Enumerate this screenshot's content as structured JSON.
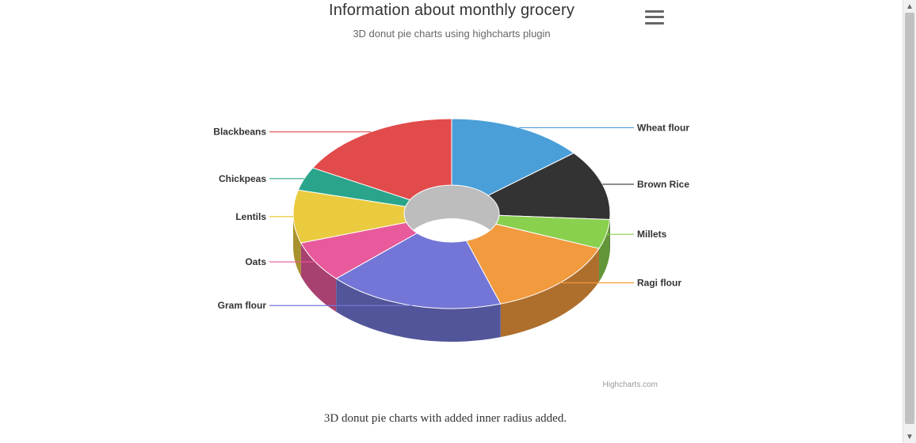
{
  "chart_data": {
    "type": "pie",
    "title": "Information about monthly grocery",
    "subtitle": "3D donut pie charts using highcharts plugin",
    "caption": "3D donut pie charts with added inner radius added.",
    "credits": "Highcharts.com",
    "inner_radius_pct": 30,
    "slices": [
      {
        "name": "Wheat flour",
        "value": 14,
        "color": "#4a9fd8"
      },
      {
        "name": "Brown Rice",
        "value": 12,
        "color": "#333333"
      },
      {
        "name": "Millets",
        "value": 5,
        "color": "#89d04f"
      },
      {
        "name": "Ragi flour",
        "value": 14,
        "color": "#f19a3e"
      },
      {
        "name": "Gram flour",
        "value": 18,
        "color": "#7376d6"
      },
      {
        "name": "Oats",
        "value": 7,
        "color": "#e85a9b"
      },
      {
        "name": "Lentils",
        "value": 9,
        "color": "#eacb3f"
      },
      {
        "name": "Chickpeas",
        "value": 4,
        "color": "#2aa58b"
      },
      {
        "name": "Blackbeans",
        "value": 17,
        "color": "#e24b4b"
      }
    ]
  },
  "menu": {
    "tooltip": "Chart context menu"
  }
}
